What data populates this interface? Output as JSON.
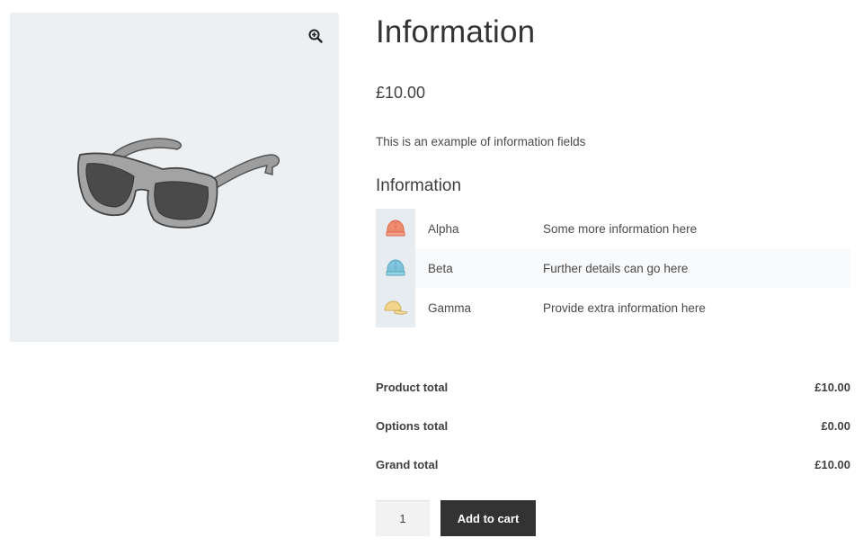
{
  "gallery": {
    "zoom_icon": "zoom-in-icon",
    "image": "sunglasses-product-image",
    "background_color": "#ecf0f3"
  },
  "product": {
    "title": "Information",
    "price": "£10.00",
    "description": "This is an example of information fields"
  },
  "info_section": {
    "title": "Information",
    "rows": [
      {
        "name": "Alpha",
        "detail": "Some more information here",
        "icon": "red-cap-icon",
        "color": "#f08a6e"
      },
      {
        "name": "Beta",
        "detail": "Further details can go here",
        "icon": "blue-cap-icon",
        "color": "#7fc4dc"
      },
      {
        "name": "Gamma",
        "detail": "Provide extra information here",
        "icon": "yellow-cap-icon",
        "color": "#f2d58a"
      }
    ]
  },
  "totals": [
    {
      "label": "Product total",
      "value": "£10.00"
    },
    {
      "label": "Options total",
      "value": "£0.00"
    },
    {
      "label": "Grand total",
      "value": "£10.00"
    }
  ],
  "cart": {
    "quantity": "1",
    "add_label": "Add to cart",
    "button_color": "#333333"
  }
}
